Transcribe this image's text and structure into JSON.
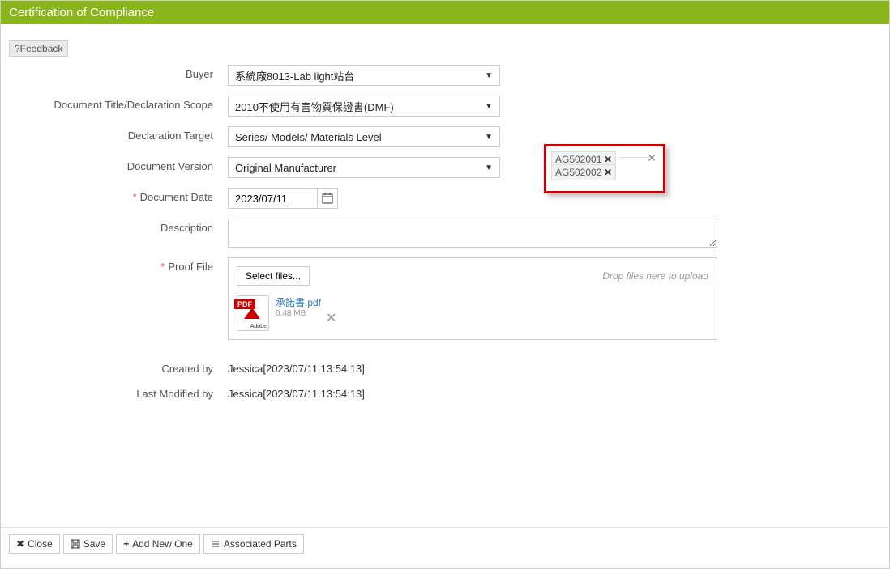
{
  "header": {
    "title": "Certification of Compliance"
  },
  "feedback": {
    "label": "?Feedback"
  },
  "form": {
    "buyer": {
      "label": "Buyer",
      "value": "系統廠8013-Lab light站台"
    },
    "scope": {
      "label": "Document Title/Declaration Scope",
      "value": "2010不使用有害物質保證書(DMF)"
    },
    "target": {
      "label": "Declaration Target",
      "value": "Series/ Models/ Materials Level"
    },
    "version": {
      "label": "Document Version",
      "value": "Original Manufacturer"
    },
    "date": {
      "label": "Document Date",
      "value": "2023/07/11"
    },
    "desc": {
      "label": "Description",
      "value": ""
    },
    "proof": {
      "label": "Proof File",
      "select_files": "Select files...",
      "drop_hint": "Drop files here to upload",
      "file": {
        "name": "承諾書.pdf",
        "size": "0.48 MB"
      }
    },
    "created": {
      "label": "Created by",
      "value": "Jessica[2023/07/11 13:54:13]"
    },
    "modified": {
      "label": "Last Modified by",
      "value": "Jessica[2023/07/11 13:54:13]"
    }
  },
  "popup": {
    "items": [
      "AG502001",
      "AG502002"
    ]
  },
  "buttons": {
    "close": "Close",
    "save": "Save",
    "add": "Add New One",
    "assoc": "Associated Parts"
  }
}
